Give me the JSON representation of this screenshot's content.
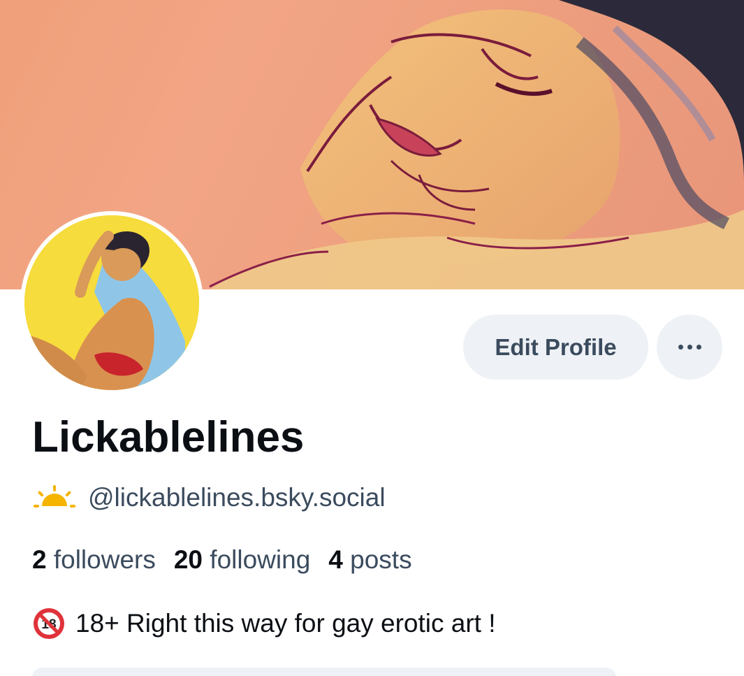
{
  "profile": {
    "display_name": "Lickablelines",
    "handle": "@lickablelines.bsky.social",
    "bio": "18+ Right this way for gay erotic art !"
  },
  "stats": {
    "followers_count": "2",
    "followers_label": "followers",
    "following_count": "20",
    "following_label": "following",
    "posts_count": "4",
    "posts_label": "posts"
  },
  "actions": {
    "edit_profile_label": "Edit Profile"
  },
  "icons": {
    "handle_prefix": "sun-rising-icon",
    "bio_prefix": "no-one-under-eighteen-icon",
    "more": "more-horizontal-icon"
  },
  "colors": {
    "button_bg": "#eef1f5",
    "secondary_text": "#3b4b5e",
    "primary_text": "#0b0f14"
  }
}
